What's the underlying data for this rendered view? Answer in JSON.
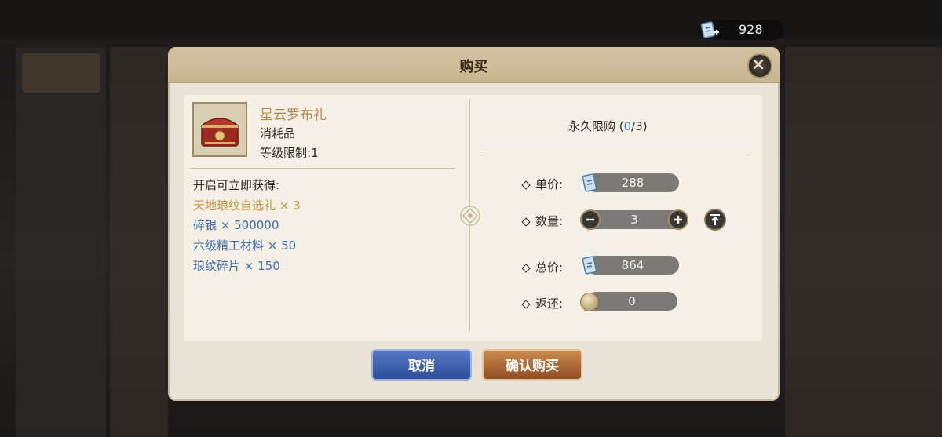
{
  "currency": {
    "value": "928",
    "icon": "ticket-plus-icon"
  },
  "dialog": {
    "title": "购买",
    "item": {
      "name": "星云罗布礼",
      "type": "消耗品",
      "level_limit": "等级限制:1",
      "icon": "treasure-chest-icon"
    },
    "gains": {
      "title": "开启可立即获得:",
      "rewards": [
        {
          "text": "天地琅纹自选礼 × 3",
          "color": "#c2963c"
        },
        {
          "text": "碎银 × 500000",
          "color": "#3f6ea8"
        },
        {
          "text": "六级精工材料 × 50",
          "color": "#3f6ea8"
        },
        {
          "text": "琅纹碎片 × 150",
          "color": "#3f6ea8"
        }
      ]
    },
    "limit": {
      "label": "永久限购 (",
      "current": "0",
      "max": "/3)"
    },
    "unit_price": {
      "label": "单价:",
      "value": "288"
    },
    "quantity": {
      "label": "数量:",
      "value": "3"
    },
    "total_price": {
      "label": "总价:",
      "value": "864"
    },
    "refund": {
      "label": "返还:",
      "value": "0"
    },
    "buttons": {
      "cancel": "取消",
      "confirm": "确认购买"
    }
  }
}
